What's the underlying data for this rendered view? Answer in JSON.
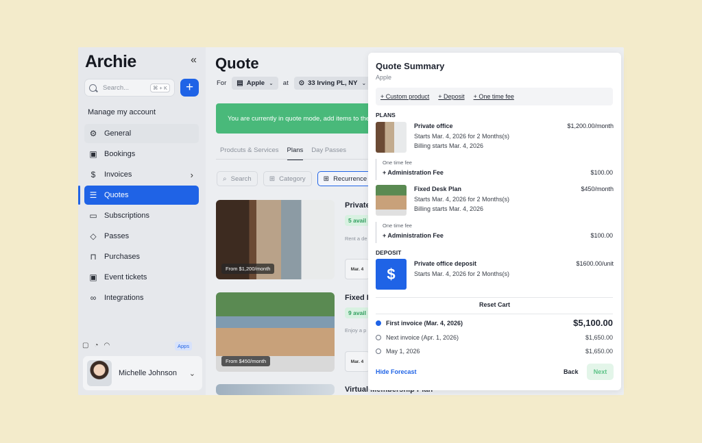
{
  "app": {
    "logo": "Archie",
    "collapse_icon": "«",
    "search": {
      "placeholder": "Search...",
      "shortcut": "⌘ + K"
    },
    "add_label": "+",
    "manage_account": "Manage my account",
    "nav": [
      {
        "label": "General",
        "icon": "gear-icon",
        "glyph": "⚙"
      },
      {
        "label": "Bookings",
        "icon": "calendar-icon",
        "glyph": "▣"
      },
      {
        "label": "Invoices",
        "icon": "dollar-icon",
        "glyph": "$"
      },
      {
        "label": "Quotes",
        "icon": "clipboard-icon",
        "glyph": "☰"
      },
      {
        "label": "Subscriptions",
        "icon": "document-icon",
        "glyph": "▭"
      },
      {
        "label": "Passes",
        "icon": "tag-icon",
        "glyph": "◇"
      },
      {
        "label": "Purchases",
        "icon": "bag-icon",
        "glyph": "⊓"
      },
      {
        "label": "Event tickets",
        "icon": "calendar-icon",
        "glyph": "▣"
      },
      {
        "label": "Integrations",
        "icon": "link-icon",
        "glyph": "∞"
      }
    ],
    "apps_badge": "Apps",
    "user": {
      "name": "Michelle Johnson"
    }
  },
  "main": {
    "title": "Quote",
    "for_label": "For",
    "company": "Apple",
    "at_label": "at",
    "location": "33 Irving PL, NY",
    "banner": "You are currently in quote mode, add items to the",
    "tabs": [
      "Prodcuts & Services",
      "Plans",
      "Day Passes"
    ],
    "filters": {
      "search": "Search",
      "category": "Category",
      "recurrence": "Recurrence"
    },
    "cards": [
      {
        "title": "Private",
        "price_tag": "From $1,200/month",
        "avail": "5 avail",
        "desc": "Rent a de",
        "date": "Mar. 4"
      },
      {
        "title": "Fixed I",
        "price_tag": "From $450/month",
        "avail": "9 avail",
        "desc": "Enjoy a p",
        "date": "Mar. 4"
      },
      {
        "title": "Virtual Membership Plan"
      }
    ]
  },
  "summary": {
    "title": "Quote Summary",
    "subtitle": "Apple",
    "actions": [
      "+ Custom product",
      "+ Deposit",
      "+ One time fee"
    ],
    "plans_heading": "PLANS",
    "plans": [
      {
        "name": "Private office",
        "price": "$1,200.00/month",
        "starts": "Starts Mar. 4, 2026 for 2 Months(s)",
        "billing": "Billing starts Mar. 4, 2026",
        "fee": {
          "label": "One time fee",
          "name": "+ Administration Fee",
          "price": "$100.00"
        }
      },
      {
        "name": "Fixed Desk Plan",
        "price": "$450/month",
        "starts": "Starts Mar. 4, 2026 for 2 Months(s)",
        "billing": "Billing starts Mar. 4, 2026",
        "fee": {
          "label": "One time fee",
          "name": "+ Administration Fee",
          "price": "$100.00"
        }
      }
    ],
    "deposit_heading": "DEPOSIT",
    "deposit": {
      "icon_glyph": "$",
      "name": "Private office deposit",
      "price": "$1600.00/unit",
      "starts": "Starts Mar. 4, 2026 for 2 Months(s)"
    },
    "reset_label": "Reset Cart",
    "invoices": [
      {
        "label": "First invoice (Mar. 4, 2026)",
        "amount": "$5,100.00",
        "selected": true
      },
      {
        "label": "Next invoice (Apr. 1, 2026)",
        "amount": "$1,650.00",
        "selected": false
      },
      {
        "label": "May 1, 2026",
        "amount": "$1,650.00",
        "selected": false
      }
    ],
    "hide_forecast": "Hide Forecast",
    "back": "Back",
    "next": "Next"
  }
}
